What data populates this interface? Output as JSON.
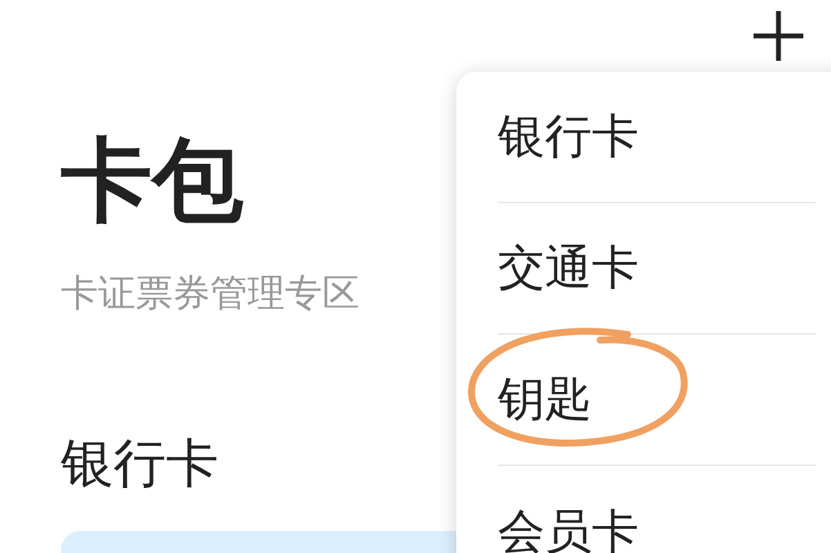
{
  "header": {
    "title": "卡包",
    "subtitle": "卡证票券管理专区"
  },
  "section": {
    "title": "银行卡"
  },
  "menu": {
    "items": [
      {
        "label": "银行卡",
        "circled": false
      },
      {
        "label": "交通卡",
        "circled": false
      },
      {
        "label": "钥匙",
        "circled": true
      },
      {
        "label": "会员卡",
        "circled": false
      }
    ]
  }
}
